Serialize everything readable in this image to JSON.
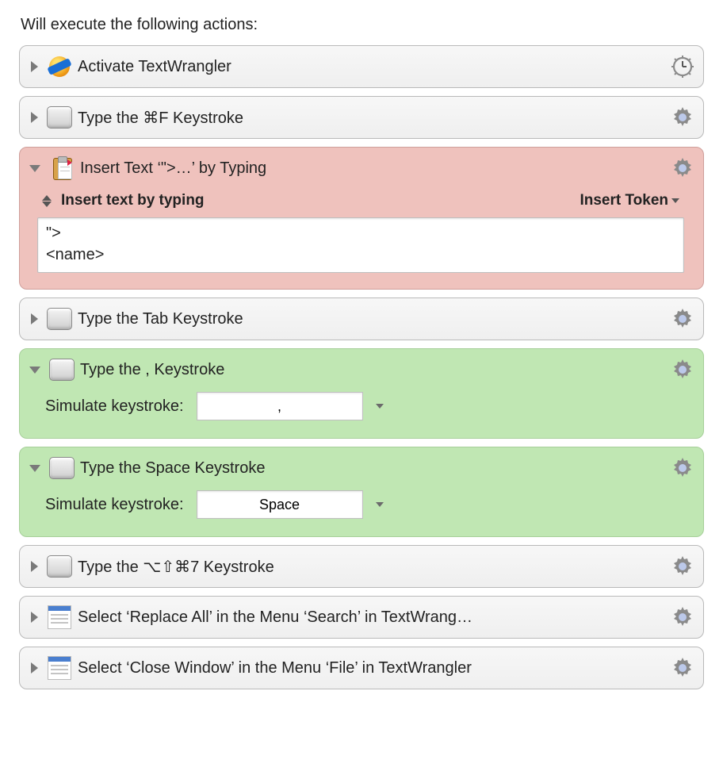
{
  "heading": "Will execute the following actions:",
  "insert_text_body": {
    "mode_label": "Insert text by typing",
    "token_button": "Insert Token",
    "text_value": "\">\n<name>"
  },
  "keystroke_body": {
    "label": "Simulate keystroke:"
  },
  "actions": [
    {
      "title": "Activate TextWrangler",
      "icon": "app",
      "expanded": false,
      "gear": "clock"
    },
    {
      "title": "Type the ⌘F Keystroke",
      "icon": "key",
      "expanded": false,
      "gear": "gear"
    },
    {
      "title": "Insert Text ‘\">…’ by Typing",
      "icon": "paste",
      "expanded": true,
      "color": "pink",
      "gear": "gear"
    },
    {
      "title": "Type the Tab Keystroke",
      "icon": "key",
      "expanded": false,
      "gear": "gear"
    },
    {
      "title": "Type the , Keystroke",
      "icon": "key",
      "expanded": true,
      "color": "green",
      "key_value": ",",
      "gear": "gear"
    },
    {
      "title": "Type the Space Keystroke",
      "icon": "key",
      "expanded": true,
      "color": "green",
      "key_value": "Space",
      "gear": "gear"
    },
    {
      "title": "Type the ⌥⇧⌘7 Keystroke",
      "icon": "key",
      "expanded": false,
      "gear": "gear"
    },
    {
      "title": "Select ‘Replace All’ in the Menu ‘Search’ in TextWrang…",
      "icon": "menu",
      "expanded": false,
      "gear": "gear"
    },
    {
      "title": "Select ‘Close Window’ in the Menu ‘File’ in TextWrangler",
      "icon": "menu",
      "expanded": false,
      "gear": "gear"
    }
  ]
}
